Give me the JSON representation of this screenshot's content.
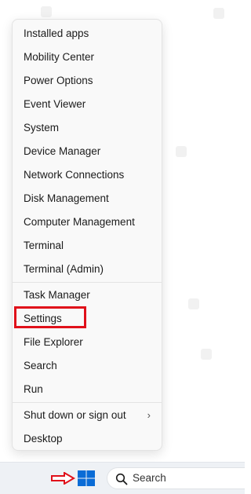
{
  "menu": {
    "items": [
      {
        "label": "Installed apps"
      },
      {
        "label": "Mobility Center"
      },
      {
        "label": "Power Options"
      },
      {
        "label": "Event Viewer"
      },
      {
        "label": "System"
      },
      {
        "label": "Device Manager"
      },
      {
        "label": "Network Connections"
      },
      {
        "label": "Disk Management"
      },
      {
        "label": "Computer Management"
      },
      {
        "label": "Terminal"
      },
      {
        "label": "Terminal (Admin)"
      },
      {
        "label": "Task Manager"
      },
      {
        "label": "Settings"
      },
      {
        "label": "File Explorer"
      },
      {
        "label": "Search"
      },
      {
        "label": "Run"
      },
      {
        "label": "Shut down or sign out",
        "has_submenu": true
      },
      {
        "label": "Desktop"
      }
    ],
    "highlighted_item": "Settings"
  },
  "taskbar": {
    "search_label": "Search"
  },
  "icons": {
    "start": "windows-logo-icon",
    "search": "search-icon",
    "submenu": "chevron-right-icon",
    "pointer": "red-arrow-icon"
  },
  "colors": {
    "highlight": "#e0101a",
    "windows_blue": "#0a6cd6",
    "menu_background": "#f9f9f9",
    "taskbar_background": "#eef1f5"
  }
}
